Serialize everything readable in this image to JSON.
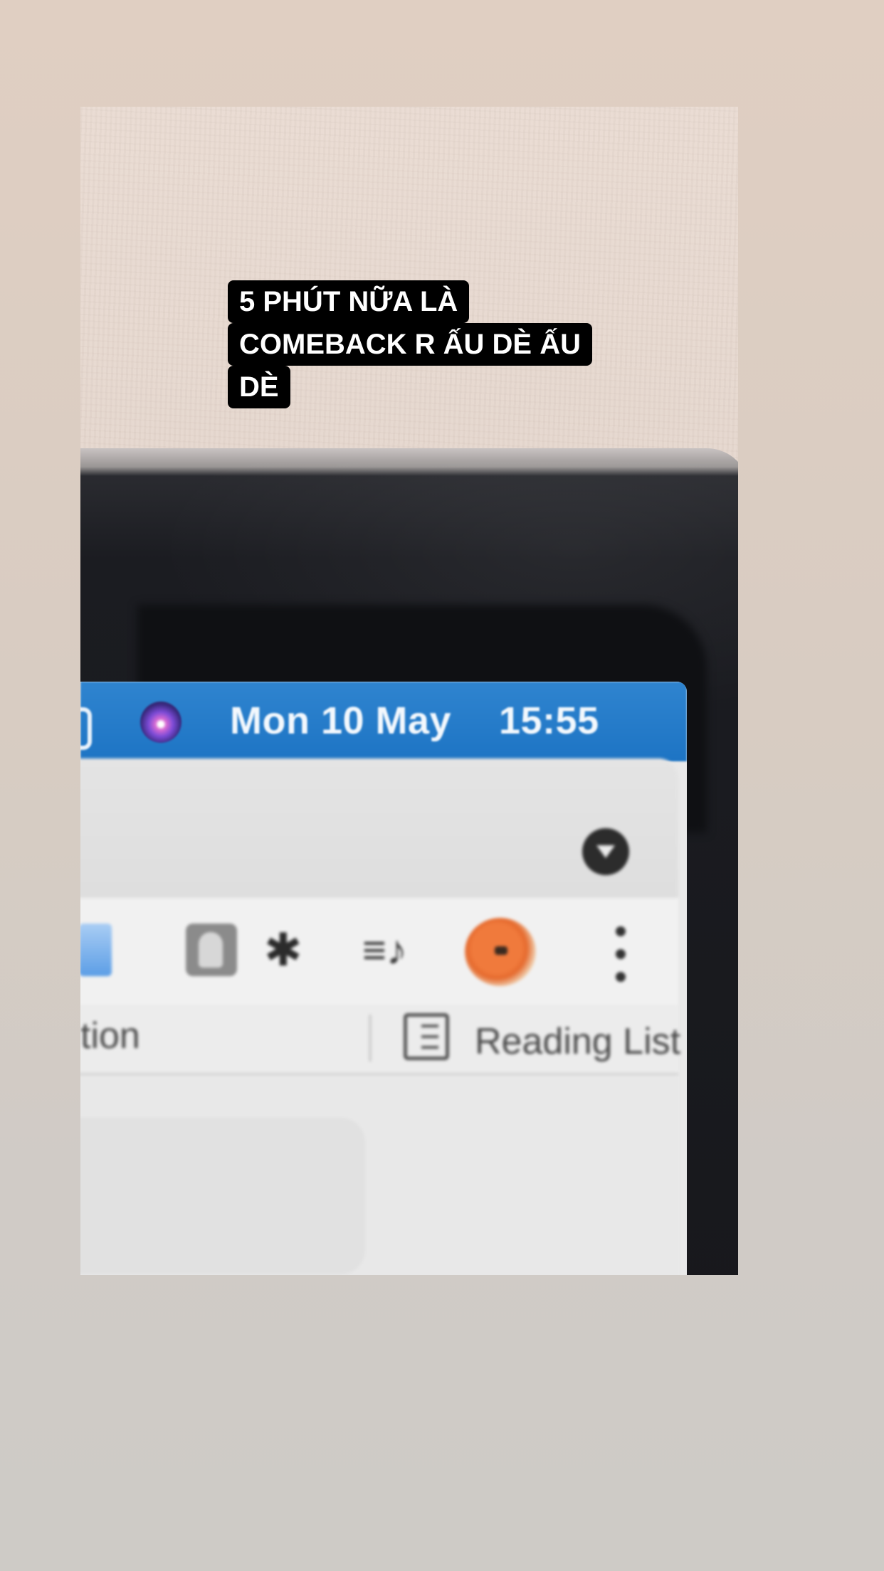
{
  "caption": "5 PHÚT NỮA LÀ COMEBACK R ẤU DÈ ẤU DÈ",
  "menubar": {
    "date": "Mon 10 May",
    "time": "15:55",
    "accent_color": "#1d74c4",
    "icons": [
      "control-center-icon",
      "siri-icon"
    ]
  },
  "browser": {
    "toolbar_icons": [
      "file-icon",
      "profile-icon",
      "puzzle-icon",
      "media-control-icon",
      "avatar",
      "more-icon"
    ],
    "bookmarks": {
      "partial_item": "tion",
      "reading_list": "Reading List"
    }
  }
}
